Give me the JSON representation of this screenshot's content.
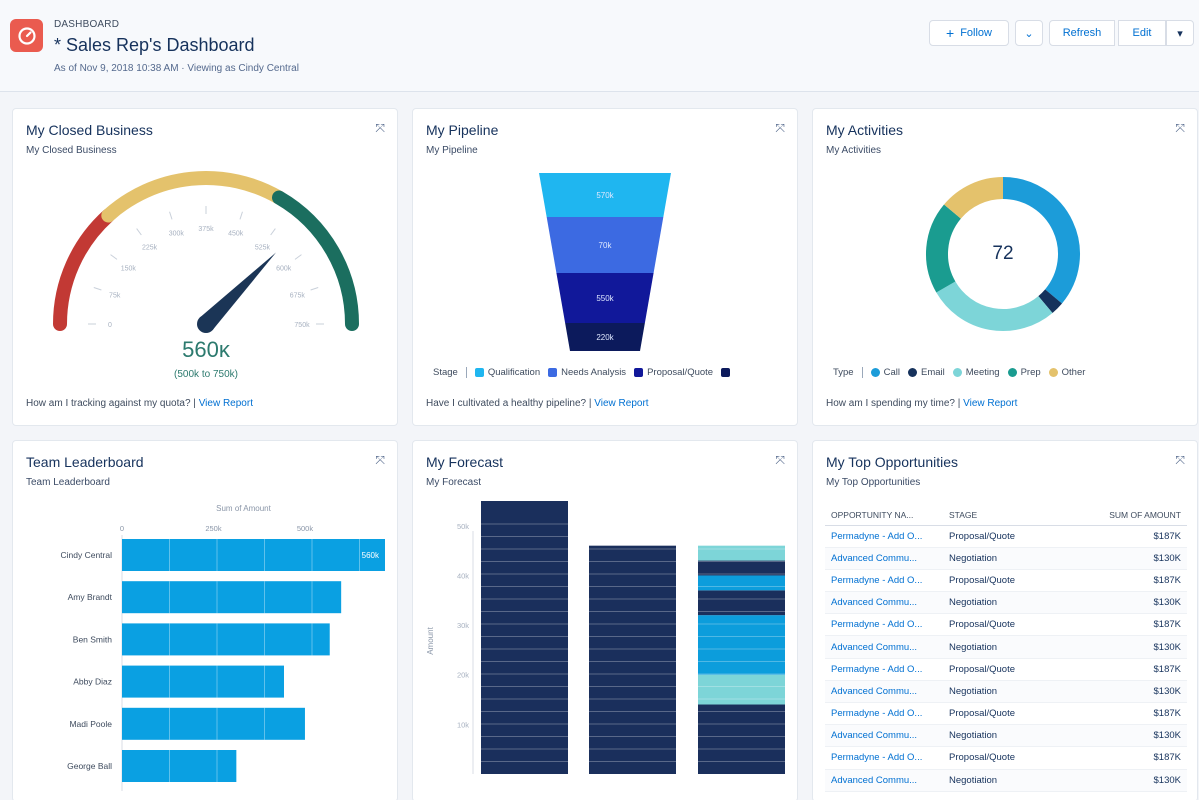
{
  "header": {
    "label": "DASHBOARD",
    "title": "* Sales Rep's Dashboard",
    "subtitle": "As of Nov 9, 2018 10:38 AM · Viewing as Cindy Central",
    "follow_label": "Follow",
    "more_label": "⌄",
    "refresh_label": "Refresh",
    "edit_label": "Edit",
    "caret_label": "▾"
  },
  "expand_glyph": "⤧",
  "closed_business": {
    "title": "My Closed Business",
    "subtitle": "My Closed Business",
    "value": "560ĸ",
    "range": "(500k to 750k)",
    "footer_text": "How am I tracking against my quota?",
    "footer_sep": " | ",
    "footer_link": "View Report",
    "gauge": {
      "min": 0,
      "max": 750,
      "value": 560,
      "ticks": [
        "0",
        "75k",
        "150k",
        "225k",
        "300k",
        "375k",
        "450k",
        "525k",
        "600k",
        "675k",
        "750k"
      ],
      "bands": [
        {
          "from": 0,
          "to": 200,
          "color": "#c23934"
        },
        {
          "from": 200,
          "to": 500,
          "color": "#e4c26c"
        },
        {
          "from": 500,
          "to": 750,
          "color": "#1b6e5f"
        }
      ],
      "needle_color": "#1b3556"
    }
  },
  "pipeline": {
    "title": "My Pipeline",
    "subtitle": "My Pipeline",
    "legend_title": "Stage",
    "footer_text": "Have I cultivated a healthy pipeline?",
    "footer_sep": " | ",
    "footer_link": "View Report"
  },
  "activities": {
    "title": "My Activities",
    "subtitle": "My Activities",
    "total": "72",
    "legend_title": "Type",
    "footer_text": "How am I spending my time?",
    "footer_sep": " | ",
    "footer_link": "View Report"
  },
  "leaderboard": {
    "title": "Team Leaderboard",
    "subtitle": "Team Leaderboard"
  },
  "forecast": {
    "title": "My Forecast",
    "subtitle": "My Forecast"
  },
  "opportunities": {
    "title": "My Top Opportunities",
    "subtitle": "My Top Opportunities",
    "columns": [
      "OPPORTUNITY NA...",
      "STAGE",
      "SUM OF AMOUNT"
    ],
    "rows": [
      [
        "Permadyne - Add O...",
        "Proposal/Quote",
        "$187K"
      ],
      [
        "Advanced Commu...",
        "Negotiation",
        "$130K"
      ],
      [
        "Permadyne - Add O...",
        "Proposal/Quote",
        "$187K"
      ],
      [
        "Advanced Commu...",
        "Negotiation",
        "$130K"
      ],
      [
        "Permadyne - Add O...",
        "Proposal/Quote",
        "$187K"
      ],
      [
        "Advanced Commu...",
        "Negotiation",
        "$130K"
      ],
      [
        "Permadyne - Add O...",
        "Proposal/Quote",
        "$187K"
      ],
      [
        "Advanced Commu...",
        "Negotiation",
        "$130K"
      ],
      [
        "Permadyne - Add O...",
        "Proposal/Quote",
        "$187K"
      ],
      [
        "Advanced Commu...",
        "Negotiation",
        "$130K"
      ],
      [
        "Permadyne - Add O...",
        "Proposal/Quote",
        "$187K"
      ],
      [
        "Advanced Commu...",
        "Negotiation",
        "$130K"
      ]
    ]
  },
  "colors": {
    "brand_icon": "#ea5b4f",
    "link": "#0070d2"
  },
  "chart_data": [
    {
      "type": "funnel",
      "title": "My Pipeline",
      "legend_title": "Stage",
      "categories": [
        "Qualification",
        "Needs Analysis",
        "Proposal/Quote",
        ""
      ],
      "labels": [
        "570k",
        "70k",
        "550k",
        "220k"
      ],
      "values": [
        570,
        70,
        550,
        220
      ],
      "colors": [
        "#1fb6f0",
        "#3c6ae2",
        "#11189a",
        "#0c1a5c"
      ]
    },
    {
      "type": "pie",
      "title": "My Activities",
      "legend_title": "Type",
      "categories": [
        "Call",
        "Email",
        "Meeting",
        "Prep",
        "Other"
      ],
      "values": [
        26,
        2,
        20,
        14,
        10
      ],
      "colors": [
        "#1c9cd9",
        "#16325c",
        "#7dd5d8",
        "#1a9c90",
        "#e4c26c"
      ],
      "total": 72
    },
    {
      "type": "bar",
      "orientation": "horizontal",
      "title": "Team Leaderboard",
      "xlabel": "Sum of Amount",
      "ticks": [
        "0",
        "250k",
        "500k"
      ],
      "xlim": [
        0,
        690
      ],
      "categories": [
        "Cindy Central",
        "Amy Brandt",
        "Ben Smith",
        "Abby Diaz",
        "Madi Poole",
        "George Ball"
      ],
      "values": [
        690,
        575,
        545,
        425,
        480,
        300
      ],
      "data_labels": [
        "560k",
        "",
        "",
        "",
        "",
        ""
      ],
      "color": "#0aa0e2"
    },
    {
      "type": "bar",
      "stacked": true,
      "title": "My Forecast",
      "ylabel": "Amount",
      "ticks": [
        "10k",
        "20k",
        "30k",
        "40k",
        "50k"
      ],
      "ylim": [
        0,
        55
      ],
      "categories": [
        "",
        "",
        ""
      ],
      "series": [
        {
          "values": [
            55,
            46,
            14
          ],
          "color": "#1a2f5c"
        },
        {
          "values": [
            0,
            0,
            6
          ],
          "color": "#7dd5d8"
        },
        {
          "values": [
            0,
            0,
            12
          ],
          "color": "#0c9ddc"
        },
        {
          "values": [
            0,
            0,
            5
          ],
          "color": "#1a2f5c"
        },
        {
          "values": [
            0,
            0,
            3
          ],
          "color": "#0c9ddc"
        },
        {
          "values": [
            0,
            0,
            3
          ],
          "color": "#1a2f5c"
        },
        {
          "values": [
            0,
            0,
            3
          ],
          "color": "#7dd5d8"
        }
      ]
    }
  ]
}
